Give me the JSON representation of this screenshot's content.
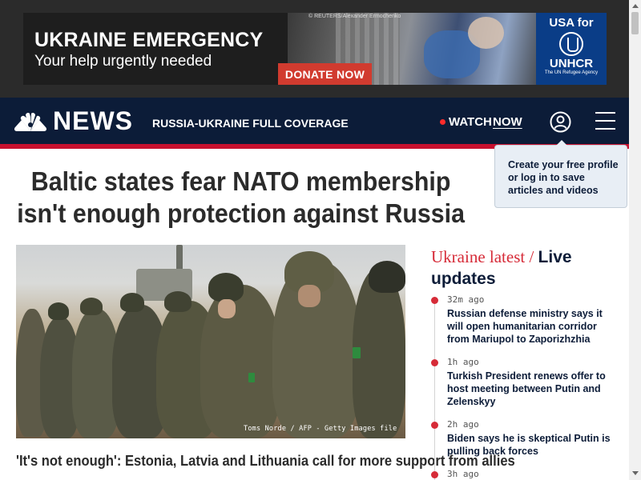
{
  "ad": {
    "headline": "UKRAINE EMERGENCY",
    "subheadline": "Your help urgently needed",
    "photo_credit": "© REUTERS/Alexander Ermochenko",
    "donate_label": "DONATE NOW",
    "brand_line1": "USA for",
    "brand_line2": "UNHCR",
    "brand_line3": "The UN Refugee Agency"
  },
  "nav": {
    "logo_text": "NEWS",
    "coverage_link": "RUSSIA-UKRAINE FULL COVERAGE",
    "watch_label": "WATCH",
    "now_label": "NOW",
    "profile_icon": "user-circle-icon",
    "menu_icon": "hamburger-menu-icon",
    "colors": {
      "background": "#0c1c38",
      "accent": "#c8102e"
    }
  },
  "tooltip": {
    "text": "Create your free profile or log in to save articles and videos"
  },
  "article": {
    "headline": "Baltic states fear NATO membership isn't enough protection against Russia",
    "photo_credit": "Toms Norde / AFP - Getty Images file",
    "caption": "'It's not enough': Estonia, Latvia and Lithuania call for more support from allies"
  },
  "live_updates": {
    "title_part1": "Ukraine latest / ",
    "title_part2": "Live updates",
    "items": [
      {
        "time": "32m ago",
        "text": "Russian defense ministry says it will open humanitarian corridor from Mariupol to Zaporizhzhia"
      },
      {
        "time": "1h ago",
        "text": "Turkish President renews offer to host meeting between Putin and Zelenskyy"
      },
      {
        "time": "2h ago",
        "text": "Biden says he is skeptical Putin is pulling back forces"
      },
      {
        "time": "3h ago",
        "text": ""
      }
    ],
    "colors": {
      "accent": "#d62b38"
    }
  }
}
